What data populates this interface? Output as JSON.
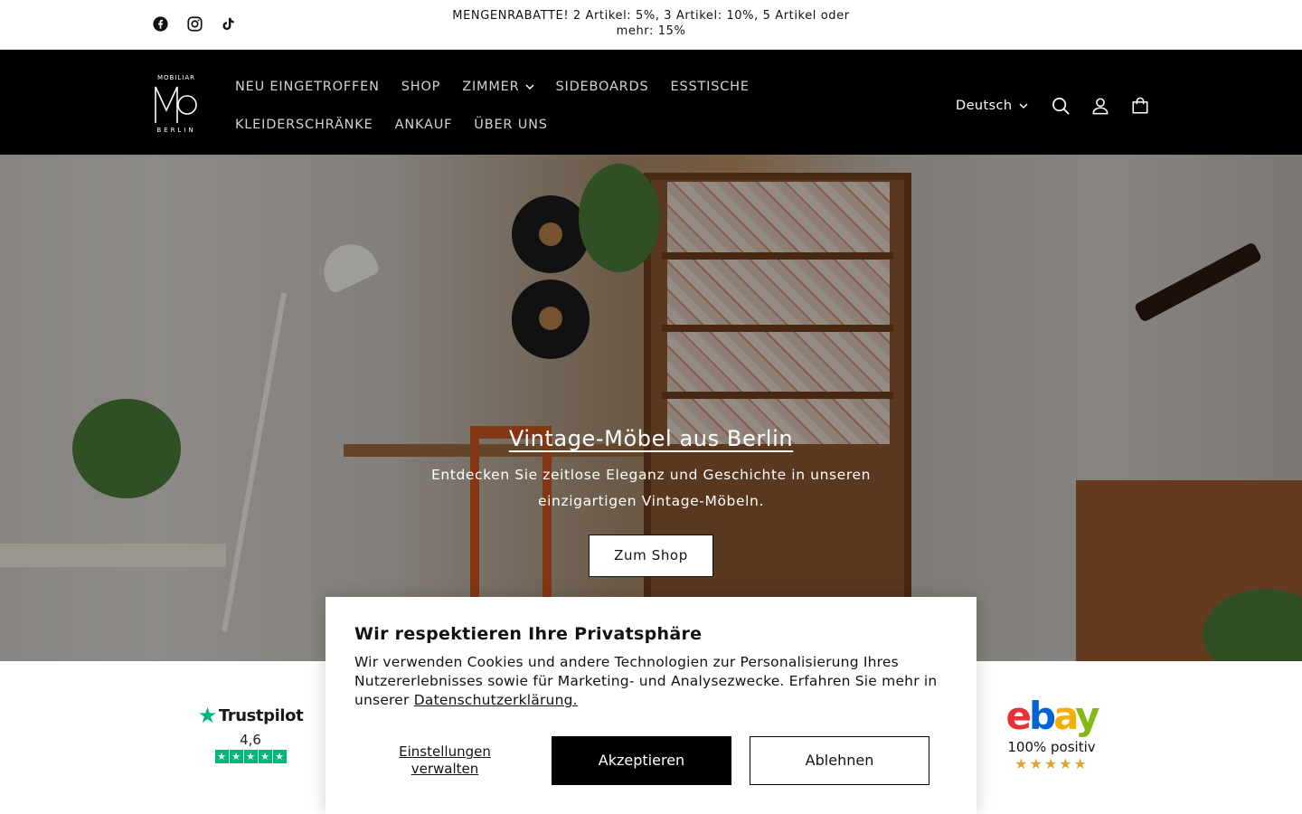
{
  "announcement": {
    "text": "MENGENRABATTE! 2 Artikel: 5%, 3 Artikel: 10%, 5 Artikel oder mehr: 15%",
    "socials": [
      "facebook-icon",
      "instagram-icon",
      "tiktok-icon"
    ]
  },
  "header": {
    "logo": {
      "top": "MOBILIAR",
      "mark": "MO",
      "bottom": "BERLIN"
    },
    "nav": [
      {
        "label": "NEU EINGETROFFEN"
      },
      {
        "label": "SHOP"
      },
      {
        "label": "ZIMMER",
        "has_dropdown": true
      },
      {
        "label": "SIDEBOARDS"
      },
      {
        "label": "ESSTISCHE"
      },
      {
        "label": "KLEIDERSCHRÄNKE"
      },
      {
        "label": "ANKAUF"
      },
      {
        "label": "ÜBER UNS"
      }
    ],
    "language": "Deutsch",
    "icons": [
      "search-icon",
      "account-icon",
      "cart-icon"
    ]
  },
  "hero": {
    "title": "Vintage-Möbel aus Berlin",
    "subtitle": "Entdecken Sie zeitlose Eleganz und Geschichte in unseren einzigartigen Vintage-Möbeln.",
    "cta": "Zum Shop"
  },
  "trust": {
    "trustpilot": {
      "brand": "Trustpilot",
      "rating": "4,6",
      "stars": 5
    },
    "ebay": {
      "label": "100% positiv",
      "stars": 5
    }
  },
  "cookie": {
    "title": "Wir respektieren Ihre Privatsphäre",
    "text": "Wir verwenden Cookies und andere Technologien zur Personalisierung Ihres Nutzererlebnisses sowie für Marketing- und Analysezwecke. Erfahren Sie mehr in unserer",
    "link": "Datenschutzerklärung.",
    "manage": "Einstellungen verwalten",
    "accept": "Akzeptieren",
    "decline": "Ablehnen"
  },
  "colors": {
    "header_bg": "#000000",
    "trustpilot_green": "#00b67a",
    "accent_button": "#000000"
  }
}
